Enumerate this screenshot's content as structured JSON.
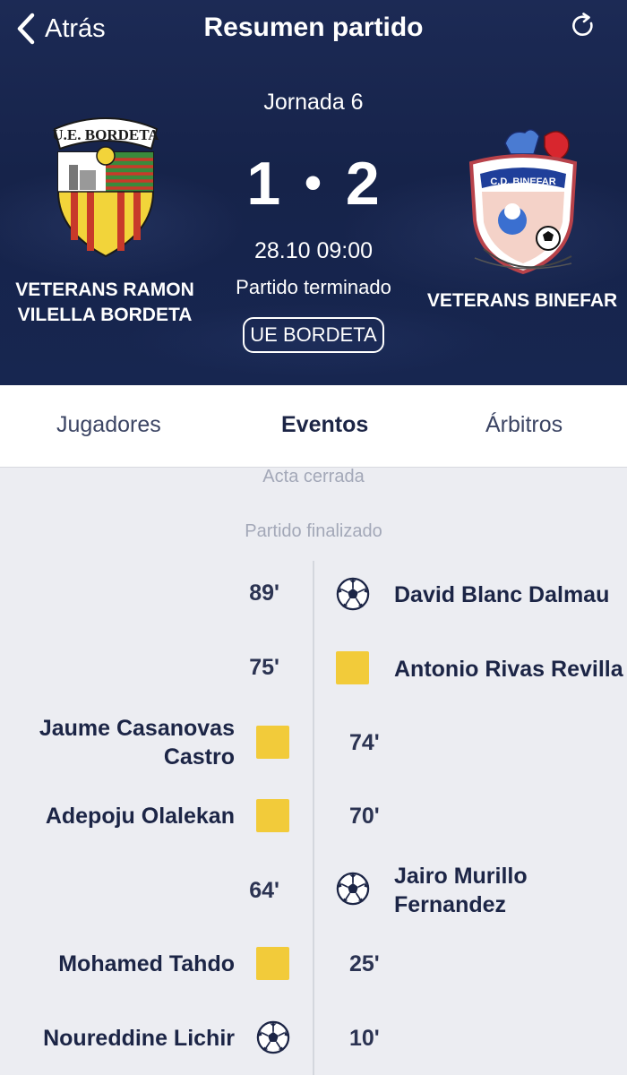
{
  "nav": {
    "back_label": "Atrás",
    "title": "Resumen partido",
    "refresh_icon": "refresh-icon"
  },
  "match": {
    "round": "Jornada 6",
    "home_score": "1",
    "away_score": "2",
    "score_separator": "•",
    "datetime": "28.10 09:00",
    "status": "Partido terminado",
    "venue": "UE BORDETA",
    "home": {
      "name": "VETERANS RAMON VILELLA BORDETA",
      "crest_text": "U.E. BORDETA",
      "crest_icon": "home-team-crest"
    },
    "away": {
      "name": "VETERANS BINEFAR",
      "crest_text": "C.D. BINEFAR",
      "crest_icon": "away-team-crest"
    }
  },
  "tabs": [
    {
      "label": "Jugadores",
      "active": false
    },
    {
      "label": "Eventos",
      "active": true
    },
    {
      "label": "Árbitros",
      "active": false
    }
  ],
  "events_header": {
    "closed": "Acta cerrada",
    "finished": "Partido finalizado"
  },
  "colors": {
    "header_bg": "#1c2a55",
    "yellow_card": "#f2cb3a",
    "text_dark": "#1c2546",
    "muted": "#a3a8b8"
  },
  "events": [
    {
      "minute": "89'",
      "side": "away",
      "type": "goal",
      "player": "David Blanc Dalmau",
      "icon": "soccer-ball-icon"
    },
    {
      "minute": "75'",
      "side": "away",
      "type": "yellow-card",
      "player": "Antonio Rivas Revilla",
      "icon": "yellow-card-icon"
    },
    {
      "minute": "74'",
      "side": "home",
      "type": "yellow-card",
      "player": "Jaume Casanovas Castro",
      "icon": "yellow-card-icon"
    },
    {
      "minute": "70'",
      "side": "home",
      "type": "yellow-card",
      "player": "Adepoju Olalekan",
      "icon": "yellow-card-icon"
    },
    {
      "minute": "64'",
      "side": "away",
      "type": "goal",
      "player": "Jairo Murillo Fernandez",
      "icon": "soccer-ball-icon"
    },
    {
      "minute": "25'",
      "side": "home",
      "type": "yellow-card",
      "player": "Mohamed Tahdo",
      "icon": "yellow-card-icon"
    },
    {
      "minute": "10'",
      "side": "home",
      "type": "goal",
      "player": "Noureddine Lichir",
      "icon": "soccer-ball-icon"
    }
  ]
}
